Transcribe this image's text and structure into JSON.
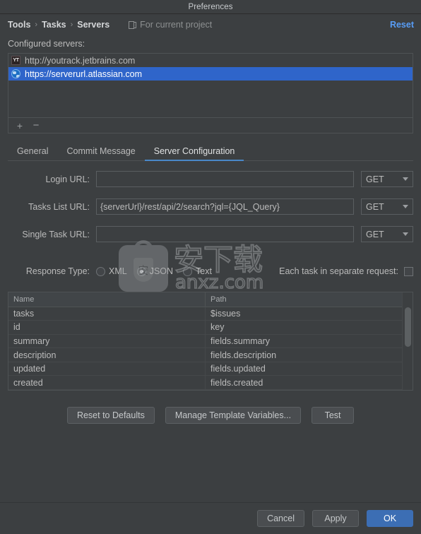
{
  "window": {
    "title": "Preferences"
  },
  "breadcrumb": {
    "items": [
      "Tools",
      "Tasks",
      "Servers"
    ],
    "separator": "›",
    "scope_label": "For current project",
    "scope_icon": "project-module-icon",
    "reset_label": "Reset"
  },
  "servers_section": {
    "label": "Configured servers:",
    "items": [
      {
        "icon": "youtrack-icon",
        "icon_text": "YT",
        "url": "http://youtrack.jetbrains.com",
        "selected": false
      },
      {
        "icon": "globe-icon",
        "icon_text": "",
        "url": "https://serverurl.atlassian.com",
        "selected": true
      }
    ],
    "toolbar": {
      "add_label": "+",
      "add_icon": "plus-icon",
      "remove_label": "−",
      "remove_icon": "minus-icon"
    }
  },
  "tabs": [
    {
      "label": "General",
      "active": false
    },
    {
      "label": "Commit Message",
      "active": false
    },
    {
      "label": "Server Configuration",
      "active": true
    }
  ],
  "form": {
    "rows": [
      {
        "label": "Login URL:",
        "value": "",
        "placeholder": "",
        "method": "GET"
      },
      {
        "label": "Tasks List URL:",
        "value": "{serverUrl}/rest/api/2/search?jql={JQL_Query}",
        "placeholder": "",
        "method": "GET"
      },
      {
        "label": "Single Task URL:",
        "value": "",
        "placeholder": "",
        "method": "GET"
      }
    ],
    "response_type": {
      "label": "Response Type:",
      "options": [
        {
          "label": "XML",
          "selected": false
        },
        {
          "label": "JSON",
          "selected": true
        },
        {
          "label": "Text",
          "selected": false
        }
      ]
    },
    "each_task_separate": {
      "label": "Each task in separate request:",
      "checked": false
    }
  },
  "mapping_table": {
    "columns": [
      "Name",
      "Path"
    ],
    "rows": [
      {
        "name": "tasks",
        "path": "$issues"
      },
      {
        "name": "id",
        "path": "key"
      },
      {
        "name": "summary",
        "path": "fields.summary"
      },
      {
        "name": "description",
        "path": "fields.description"
      },
      {
        "name": "updated",
        "path": "fields.updated"
      },
      {
        "name": "created",
        "path": "fields.created"
      }
    ]
  },
  "actions": {
    "reset_defaults": "Reset to Defaults",
    "manage_variables": "Manage Template Variables...",
    "test": "Test"
  },
  "footer": {
    "cancel": "Cancel",
    "apply": "Apply",
    "ok": "OK"
  },
  "watermark": {
    "cn_text": "安下载",
    "domain": "anxz.com",
    "badge_char": "安"
  },
  "colors": {
    "window_bg": "#3c3f41",
    "selection_blue": "#2f65ca",
    "link_blue": "#589df6",
    "accent_tab": "#4a88c7",
    "primary_button": "#3c6eb4",
    "text": "#bbbbbb"
  }
}
